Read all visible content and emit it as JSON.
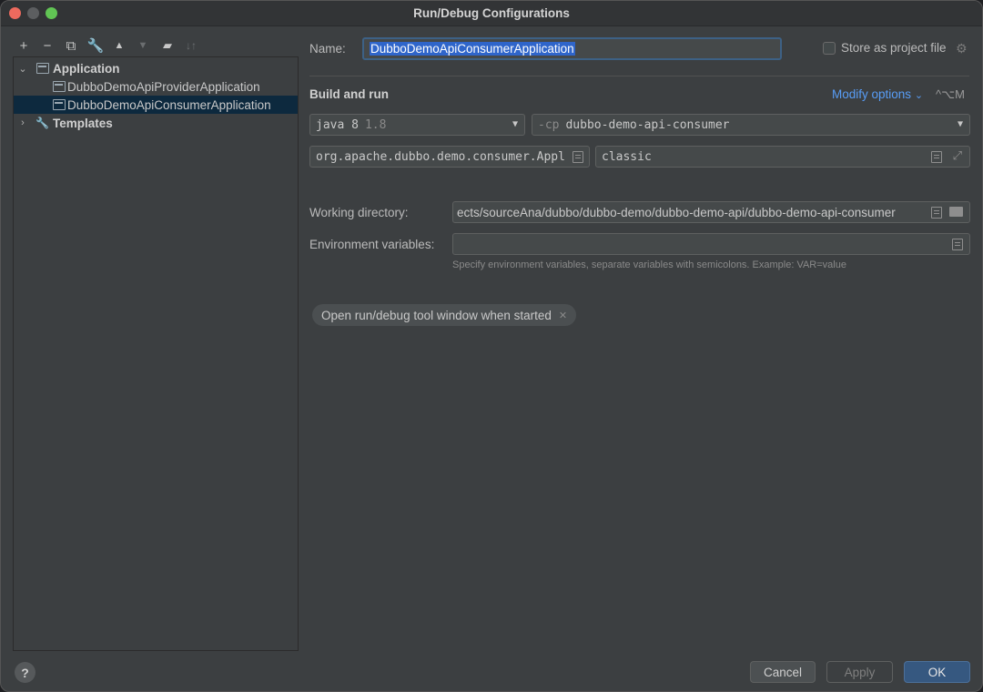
{
  "window": {
    "title": "Run/Debug Configurations"
  },
  "toolbar": {
    "icons": [
      "plus-icon",
      "minus-icon",
      "copy-icon",
      "wrench-icon",
      "arrow-up-icon",
      "arrow-down-icon",
      "folder-add-icon",
      "sort-icon"
    ]
  },
  "tree": {
    "group_application": "Application",
    "items": [
      {
        "label": "DubboDemoApiProviderApplication"
      },
      {
        "label": "DubboDemoApiConsumerApplication"
      }
    ],
    "group_templates": "Templates"
  },
  "config": {
    "name_label": "Name:",
    "name_value": "DubboDemoApiConsumerApplication",
    "store_label": "Store as project file",
    "section_title": "Build and run",
    "modify_options": "Modify options",
    "modify_chevron": "⌄",
    "modify_shortcut": "^⌥M",
    "jre_name": "java 8",
    "jre_version": "1.8",
    "cp_flag": "-cp",
    "cp_value": "dubbo-demo-api-consumer",
    "main_class": "org.apache.dubbo.demo.consumer.Appl",
    "program_args": "classic",
    "working_dir_label": "Working directory:",
    "working_dir_value": "ects/sourceAna/dubbo/dubbo-demo/dubbo-demo-api/dubbo-demo-api-consumer",
    "env_label": "Environment variables:",
    "env_value": "",
    "env_hint": "Specify environment variables, separate variables with semicolons. Example: VAR=value",
    "chip_label": "Open run/debug tool window when started"
  },
  "footer": {
    "help": "?",
    "cancel": "Cancel",
    "apply": "Apply",
    "ok": "OK"
  },
  "colors": {
    "accent": "#589df6",
    "selection": "#2f65ca",
    "ok_button": "#365880"
  }
}
